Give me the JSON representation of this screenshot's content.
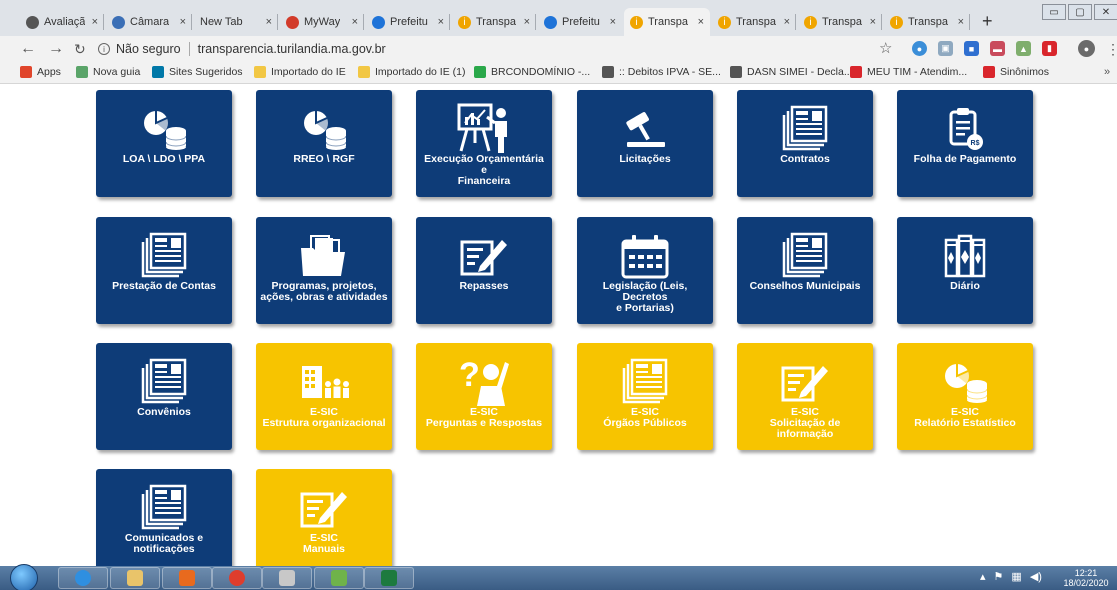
{
  "browser": {
    "tabs": [
      {
        "label": "Avaliaçã",
        "icon": "globe-icon",
        "color": "#555555"
      },
      {
        "label": "Câmara",
        "icon": "camara-icon",
        "color": "#3b6fb6"
      },
      {
        "label": "New Tab",
        "icon": "",
        "color": ""
      },
      {
        "label": "MyWay",
        "icon": "myway-icon",
        "color": "#d23b2a"
      },
      {
        "label": "Prefeitu",
        "icon": "prefeitura-icon",
        "color": "#1e73d8"
      },
      {
        "label": "Transpa",
        "icon": "info-icon",
        "color": "#f0a500"
      },
      {
        "label": "Prefeitu",
        "icon": "prefeitura-icon",
        "color": "#1e73d8"
      },
      {
        "label": "Transpa",
        "icon": "info-icon",
        "color": "#f0a500"
      },
      {
        "label": "Transpa",
        "icon": "info-icon",
        "color": "#f0a500"
      },
      {
        "label": "Transpa",
        "icon": "info-icon",
        "color": "#f0a500"
      },
      {
        "label": "Transpa",
        "icon": "info-icon",
        "color": "#f0a500"
      }
    ],
    "close_glyph": "×",
    "new_tab_glyph": "+",
    "window_controls": [
      "▭",
      "▢",
      "✕"
    ],
    "address": {
      "security_label": "Não seguro",
      "url": "transparencia.turilandia.ma.gov.br"
    },
    "bookmarks": [
      {
        "label": "Apps",
        "icon": "apps-icon",
        "color": "#e0452b"
      },
      {
        "label": "Nova guia",
        "icon": "newtab-icon",
        "color": "#5aa469"
      },
      {
        "label": "Sites Sugeridos",
        "icon": "bing-icon",
        "color": "#0078a8"
      },
      {
        "label": "Importado do IE",
        "icon": "folder-icon",
        "color": "#f2c744"
      },
      {
        "label": "Importado do IE (1)",
        "icon": "folder-icon",
        "color": "#f2c744"
      },
      {
        "label": "BRCONDOMÍNIO -...",
        "icon": "brcondominio-icon",
        "color": "#2aa84a"
      },
      {
        "label": ":: Debitos IPVA - SE...",
        "icon": "globe-icon",
        "color": "#555555"
      },
      {
        "label": "DASN SIMEI - Decla...",
        "icon": "globe-icon",
        "color": "#555555"
      },
      {
        "label": "MEU TIM - Atendim...",
        "icon": "tim-icon",
        "color": "#d9262c"
      },
      {
        "label": "Sinônimos",
        "icon": "sinonimos-icon",
        "color": "#d9262c"
      }
    ],
    "bookmarks_more": "»"
  },
  "tiles": [
    {
      "label": "LOA \\ LDO \\ PPA",
      "icon": "chart-coins-icon",
      "theme": "blue"
    },
    {
      "label": "RREO \\ RGF",
      "icon": "chart-coins-icon",
      "theme": "blue"
    },
    {
      "label": "Execução Orçamentária e\nFinanceira",
      "icon": "presentation-icon",
      "theme": "blue"
    },
    {
      "label": "Licitações",
      "icon": "gavel-icon",
      "theme": "blue"
    },
    {
      "label": "Contratos",
      "icon": "newspaper-icon",
      "theme": "blue"
    },
    {
      "label": "Folha de Pagamento",
      "icon": "clipboard-money-icon",
      "theme": "blue"
    },
    {
      "label": "Prestação de Contas",
      "icon": "newspaper-icon",
      "theme": "blue"
    },
    {
      "label": "Programas, projetos,\nações, obras e atividades",
      "icon": "folder-docs-icon",
      "theme": "blue"
    },
    {
      "label": "Repasses",
      "icon": "form-pen-icon",
      "theme": "blue"
    },
    {
      "label": "Legislação (Leis, Decretos\ne Portarias)",
      "icon": "calendar-icon",
      "theme": "blue"
    },
    {
      "label": "Conselhos Municipais",
      "icon": "newspaper-icon",
      "theme": "blue"
    },
    {
      "label": "Diário",
      "icon": "books-icon",
      "theme": "blue"
    },
    {
      "label": "Convênios",
      "icon": "newspaper-icon",
      "theme": "blue"
    },
    {
      "label": "E-SIC\nEstrutura organizacional",
      "icon": "building-people-icon",
      "theme": "yellow"
    },
    {
      "label": "E-SIC\nPerguntas e Respostas",
      "icon": "question-person-icon",
      "theme": "yellow"
    },
    {
      "label": "E-SIC\nÓrgãos Públicos",
      "icon": "newspaper-icon",
      "theme": "yellow"
    },
    {
      "label": "E-SIC\nSolicitação de\ninformação",
      "icon": "form-pen-icon",
      "theme": "yellow"
    },
    {
      "label": "E-SIC\nRelatório Estatístico",
      "icon": "chart-coins-icon",
      "theme": "yellow"
    },
    {
      "label": "Comunicados e\nnotificações",
      "icon": "newspaper-icon",
      "theme": "blue"
    },
    {
      "label": "E-SIC\nManuais",
      "icon": "form-pen-icon",
      "theme": "yellow"
    }
  ],
  "colors": {
    "tile_blue": "#0e3c78",
    "tile_yellow": "#f7c400"
  },
  "taskbar": {
    "apps": [
      {
        "icon": "ie-icon",
        "color": "#2f8fe0"
      },
      {
        "icon": "explorer-folder-icon",
        "color": "#e9c46a"
      },
      {
        "icon": "media-player-icon",
        "color": "#e86a1e"
      },
      {
        "icon": "chrome-icon",
        "color": "#de3d2d"
      },
      {
        "icon": "paint-icon",
        "color": "#c8c8c8"
      },
      {
        "icon": "pencil-app-icon",
        "color": "#6fb34a"
      },
      {
        "icon": "excel-icon",
        "color": "#1d7a3e"
      }
    ],
    "clock_time": "12:21",
    "clock_date": "18/02/2020"
  }
}
